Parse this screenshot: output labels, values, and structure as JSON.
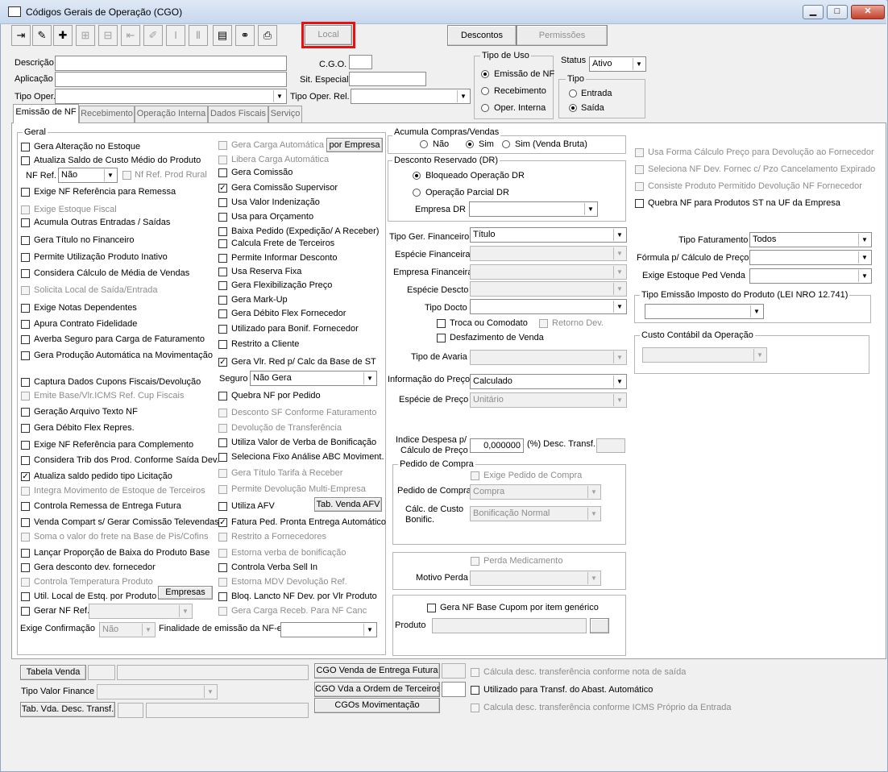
{
  "window": {
    "title": "Códigos Gerais de Operação (CGO)",
    "min": "▁",
    "max": "□",
    "close": "✕"
  },
  "toolbar": {
    "icons": [
      {
        "name": "exit-icon",
        "glyph": "⇥",
        "enabled": true
      },
      {
        "name": "edit-pencil-icon",
        "glyph": "✎",
        "enabled": true
      },
      {
        "name": "add-record-icon",
        "glyph": "✚",
        "enabled": true
      },
      {
        "name": "insert-row-icon",
        "glyph": "⊞",
        "enabled": false
      },
      {
        "name": "delete-row-icon",
        "glyph": "⊟",
        "enabled": false
      },
      {
        "name": "first-record-icon",
        "glyph": "⇤",
        "enabled": false
      },
      {
        "name": "edit-disabled-icon",
        "glyph": "✐",
        "enabled": false
      },
      {
        "name": "cursor-icon",
        "glyph": "I",
        "enabled": false
      },
      {
        "name": "pause-icon",
        "glyph": "Ⅱ",
        "enabled": false
      },
      {
        "name": "grid-list-icon",
        "glyph": "▤",
        "enabled": true
      },
      {
        "name": "binoculars-icon",
        "glyph": "⚭",
        "enabled": true
      },
      {
        "name": "print-icon",
        "glyph": "⎙",
        "enabled": true
      }
    ],
    "local": "Local",
    "descontos": "Descontos",
    "permissoes": "Permissões"
  },
  "header": {
    "descricao_label": "Descrição",
    "aplicacao_label": "Aplicação",
    "tipo_oper_label": "Tipo Oper.",
    "cgo_label": "C.G.O.",
    "sit_especial_label": "Sit. Especial",
    "tipo_oper_rel_label": "Tipo Oper. Rel.",
    "tipo_uso_label": "Tipo de Uso",
    "tipo_uso_options": [
      "Emissão de NF",
      "Recebimento",
      "Oper. Interna"
    ],
    "status_label": "Status",
    "status_value": "Ativo",
    "tipo_label": "Tipo",
    "tipo_options": [
      "Entrada",
      "Saída"
    ]
  },
  "tabs": [
    "Emissão de NF",
    "Recebimento",
    "Operação Interna",
    "Dados Fiscais",
    "Serviço"
  ],
  "geral": {
    "label": "Geral",
    "col1": [
      {
        "t": "Gera Alteração no Estoque",
        "c": false,
        "d": false
      },
      {
        "t": "Atualiza Saldo de Custo Médio do Produto",
        "c": false,
        "d": false
      },
      {
        "t": "Exige NF Referência para Remessa",
        "c": false,
        "d": false
      },
      {
        "t": "Exige Estoque Fiscal",
        "c": false,
        "d": true
      },
      {
        "t": "Acumula Outras Entradas / Saídas",
        "c": false,
        "d": false
      },
      {
        "t": "Gera Título no Financeiro",
        "c": false,
        "d": false
      },
      {
        "t": "Permite Utilização Produto Inativo",
        "c": false,
        "d": false
      },
      {
        "t": "Considera Cálculo de Média de Vendas",
        "c": false,
        "d": false
      },
      {
        "t": "Solicita Local de Saída/Entrada",
        "c": false,
        "d": true
      },
      {
        "t": "Exige Notas Dependentes",
        "c": false,
        "d": false
      },
      {
        "t": "Apura Contrato Fidelidade",
        "c": false,
        "d": false
      },
      {
        "t": "Averba Seguro para Carga de Faturamento",
        "c": false,
        "d": false
      },
      {
        "t": "Gera Produção Automática na Movimentação",
        "c": false,
        "d": false
      },
      {
        "t": "Captura Dados Cupons Fiscais/Devolução",
        "c": false,
        "d": false
      },
      {
        "t": "Emite Base/Vlr.ICMS Ref. Cup Fiscais",
        "c": false,
        "d": true
      },
      {
        "t": "Geração Arquivo Texto NF",
        "c": false,
        "d": false
      },
      {
        "t": "Gera Débito Flex Repres.",
        "c": false,
        "d": false
      },
      {
        "t": "Exige NF Referência para Complemento",
        "c": false,
        "d": false
      },
      {
        "t": "Considera Trib dos Prod. Conforme Saída Dev.",
        "c": false,
        "d": false
      },
      {
        "t": "Atualiza saldo pedido tipo Licitação",
        "c": true,
        "d": false
      },
      {
        "t": "Integra Movimento de Estoque de Terceiros",
        "c": false,
        "d": true
      },
      {
        "t": "Controla Remessa de Entrega Futura",
        "c": false,
        "d": false
      },
      {
        "t": "Venda Compart s/ Gerar Comissão Televendas",
        "c": false,
        "d": false
      },
      {
        "t": "Soma o valor do frete na Base de Pis/Cofins",
        "c": false,
        "d": true
      },
      {
        "t": "Lançar Proporção de Baixa do Produto Base",
        "c": false,
        "d": false
      },
      {
        "t": "Gera desconto dev. fornecedor",
        "c": false,
        "d": false
      },
      {
        "t": "Controla Temperatura Produto",
        "c": false,
        "d": true
      },
      {
        "t": "Util. Local de Estq. por Produto",
        "c": false,
        "d": false
      },
      {
        "t": "Gerar NF Ref.:",
        "c": false,
        "d": false
      }
    ],
    "nf_ref_label": "NF Ref.",
    "nf_ref_value": "Não",
    "nf_ref_prod_rural": "Nf Ref. Prod Rural",
    "empresas_btn": "Empresas",
    "exige_confirmacao_label": "Exige Confirmação",
    "exige_confirmacao_value": "Não",
    "finalidade_label": "Finalidade de emissão da NF-e",
    "col2": [
      {
        "t": "Gera Carga Automática",
        "c": false,
        "d": true
      },
      {
        "t": "Libera Carga Automática",
        "c": false,
        "d": true
      },
      {
        "t": "Gera Comissão",
        "c": false,
        "d": false
      },
      {
        "t": "Gera Comissão Supervisor",
        "c": true,
        "d": false
      },
      {
        "t": "Usa Valor Indenização",
        "c": false,
        "d": false
      },
      {
        "t": "Usa para Orçamento",
        "c": false,
        "d": false
      },
      {
        "t": "Baixa Pedido (Expedição/ A Receber)",
        "c": false,
        "d": false
      },
      {
        "t": "Calcula Frete de Terceiros",
        "c": false,
        "d": false
      },
      {
        "t": "Permite Informar Desconto",
        "c": false,
        "d": false
      },
      {
        "t": "Usa Reserva Fixa",
        "c": false,
        "d": false
      },
      {
        "t": "Gera Flexibilização Preço",
        "c": false,
        "d": false
      },
      {
        "t": "Gera Mark-Up",
        "c": false,
        "d": false
      },
      {
        "t": "Gera Débito Flex Fornecedor",
        "c": false,
        "d": false
      },
      {
        "t": "Utilizado para Bonif. Fornecedor",
        "c": false,
        "d": false
      },
      {
        "t": "Restrito a Cliente",
        "c": false,
        "d": false
      },
      {
        "t": "Gera Vlr. Red p/ Calc da Base de ST",
        "c": true,
        "d": false
      },
      {
        "t": "Quebra NF por Pedido",
        "c": false,
        "d": false
      },
      {
        "t": "Desconto SF Conforme Faturamento",
        "c": false,
        "d": true
      },
      {
        "t": "Devolução de Transferência",
        "c": false,
        "d": true
      },
      {
        "t": "Utiliza Valor de Verba de Bonificação",
        "c": false,
        "d": false
      },
      {
        "t": "Seleciona Fixo Análise ABC Moviment.",
        "c": false,
        "d": false
      },
      {
        "t": "Gera Título Tarifa à Receber",
        "c": false,
        "d": true
      },
      {
        "t": "Permite Devolução Multi-Empresa",
        "c": false,
        "d": true
      },
      {
        "t": "Utiliza AFV",
        "c": false,
        "d": false
      },
      {
        "t": "Fatura Ped. Pronta Entrega Automático",
        "c": true,
        "d": false
      },
      {
        "t": "Restrito a Fornecedores",
        "c": false,
        "d": true
      },
      {
        "t": "Estorna verba de bonificação",
        "c": false,
        "d": true
      },
      {
        "t": "Controla Verba Sell In",
        "c": false,
        "d": false
      },
      {
        "t": "Estorna MDV Devolução Ref.",
        "c": false,
        "d": true
      },
      {
        "t": "Bloq. Lancto NF Dev. por Vlr Produto",
        "c": false,
        "d": false
      },
      {
        "t": "Gera Carga Receb. Para NF Canc",
        "c": false,
        "d": true
      }
    ],
    "por_empresa_btn": "por Empresa",
    "seguro_label": "Seguro",
    "seguro_value": "Não Gera",
    "tab_venda_afv_btn": "Tab. Venda AFV"
  },
  "middle": {
    "acumula_label": "Acumula Compras/Vendas",
    "acumula_options": [
      "Não",
      "Sim",
      "Sim (Venda Bruta)"
    ],
    "desconto_label": "Desconto Reservado (DR)",
    "desconto_options": [
      "Bloqueado Operação DR",
      "Operação Parcial DR"
    ],
    "empresa_dr_label": "Empresa DR",
    "tipo_ger_fin_label": "Tipo Ger. Financeiro",
    "tipo_ger_fin_value": "Título",
    "especie_fin_label": "Espécie Financeira",
    "empresa_fin_label": "Empresa Financeira",
    "especie_desc_label": "Espécie Descto",
    "tipo_docto_label": "Tipo Docto",
    "troca_label": "Troca ou Comodato",
    "retorno_label": "Retorno Dev.",
    "desfazimento_label": "Desfazimento de Venda",
    "tipo_avaria_label": "Tipo de Avaria",
    "info_preco_label": "Informação do Preço",
    "info_preco_value": "Calculado",
    "especie_preco_label": "Espécie de Preço",
    "especie_preco_value": "Unitário",
    "indice_label1": "Indice Despesa p/",
    "indice_label2": "Cálculo de Preço",
    "indice_value": "0,000000",
    "desc_transf_label": "(%) Desc. Transf.",
    "pedido_compra_group": "Pedido de Compra",
    "exige_pedido_label": "Exige Pedido de Compra",
    "pedido_compra_label": "Pedido de Compra",
    "pedido_compra_value": "Compra",
    "calc_custo_label1": "Cálc. de Custo",
    "calc_custo_label2": "Bonific.",
    "calc_custo_value": "Bonificação Normal",
    "perda_med_label": "Perda Medicamento",
    "motivo_perda_label": "Motivo Perda",
    "gera_nf_base_label": "Gera NF Base Cupom por item genérico",
    "produto_label": "Produto"
  },
  "right": {
    "checks": [
      {
        "t": "Usa Forma Cálculo Preço para Devolução ao Fornecedor",
        "c": false,
        "d": true
      },
      {
        "t": "Seleciona NF Dev. Fornec c/ Pzo Cancelamento Expirado",
        "c": false,
        "d": true
      },
      {
        "t": "Consiste Produto Permitido Devolução NF Fornecedor",
        "c": false,
        "d": true
      },
      {
        "t": "Quebra NF para Produtos ST na UF da Empresa",
        "c": false,
        "d": false
      }
    ],
    "tipo_fat_label": "Tipo Faturamento",
    "tipo_fat_value": "Todos",
    "formula_label": "Fórmula p/ Cálculo de Preço",
    "exige_estoque_label": "Exige Estoque Ped Venda",
    "tipo_emissao_label": "Tipo Emissão Imposto do Produto (LEI NRO 12.741)",
    "custo_contabil_label": "Custo Contábil da Operação"
  },
  "bottom": {
    "tabela_venda_btn": "Tabela Venda",
    "tipo_valor_label": "Tipo Valor Finance",
    "tab_vda_desc_btn": "Tab. Vda. Desc. Transf.",
    "cgo_entrega_btn": "CGO Venda de Entrega Futura",
    "cgo_vda_ordem_btn": "CGO Vda a Ordem de Terceiros",
    "cgos_mov_btn": "CGOs Movimentação",
    "calc_nota_label": "Cálcula desc. transferência conforme nota de saída",
    "utilizado_transf_label": "Utilizado para Transf. do Abast. Automático",
    "calc_icms_label": "Calcula desc. transferência conforme ICMS Próprio da Entrada"
  }
}
